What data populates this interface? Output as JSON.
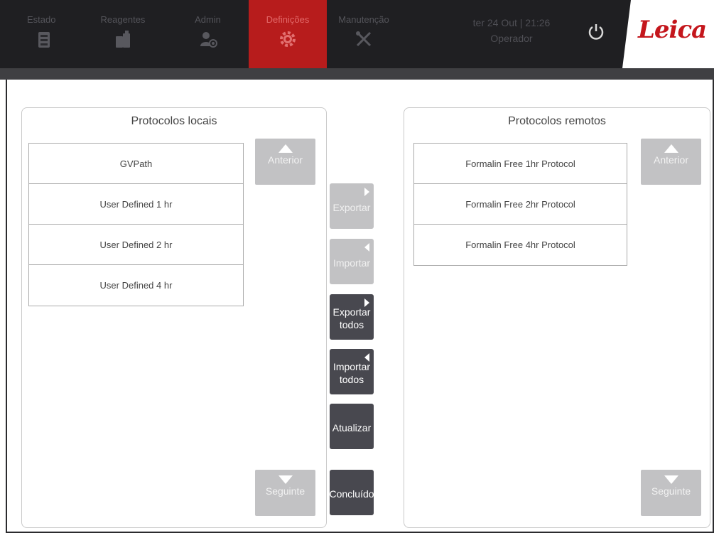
{
  "nav": {
    "tabs": [
      {
        "label": "Estado",
        "icon": "instrument-icon"
      },
      {
        "label": "Reagentes",
        "icon": "reagent-bottle-icon"
      },
      {
        "label": "Admin",
        "icon": "users-gear-icon"
      },
      {
        "label": "Definições",
        "icon": "gear-icon"
      },
      {
        "label": "Manutenção",
        "icon": "tools-icon"
      }
    ],
    "active_tab": "Definições",
    "datetime": "ter 24 Out | 21:26",
    "user": "Operador",
    "logo": "Leica"
  },
  "local": {
    "title": "Protocolos locais",
    "items": [
      "GVPath",
      "User Defined 1 hr",
      "User Defined 2 hr",
      "User Defined 4 hr"
    ],
    "prev_label": "Anterior",
    "next_label": "Seguinte"
  },
  "remote": {
    "title": "Protocolos remotos",
    "items": [
      "Formalin Free 1hr Protocol",
      "Formalin Free 2hr Protocol",
      "Formalin Free 4hr Protocol"
    ],
    "prev_label": "Anterior",
    "next_label": "Seguinte"
  },
  "actions": {
    "export": "Exportar",
    "import": "Importar",
    "export_all": "Exportar todos",
    "import_all": "Importar todos",
    "update": "Atualizar",
    "done": "Concluído"
  },
  "colors": {
    "topbar": "#1f1f22",
    "active_tab": "#b71c1c",
    "brand": "#c4161c",
    "disabled_button": "#c2c2c4",
    "dark_button": "#48484f"
  }
}
